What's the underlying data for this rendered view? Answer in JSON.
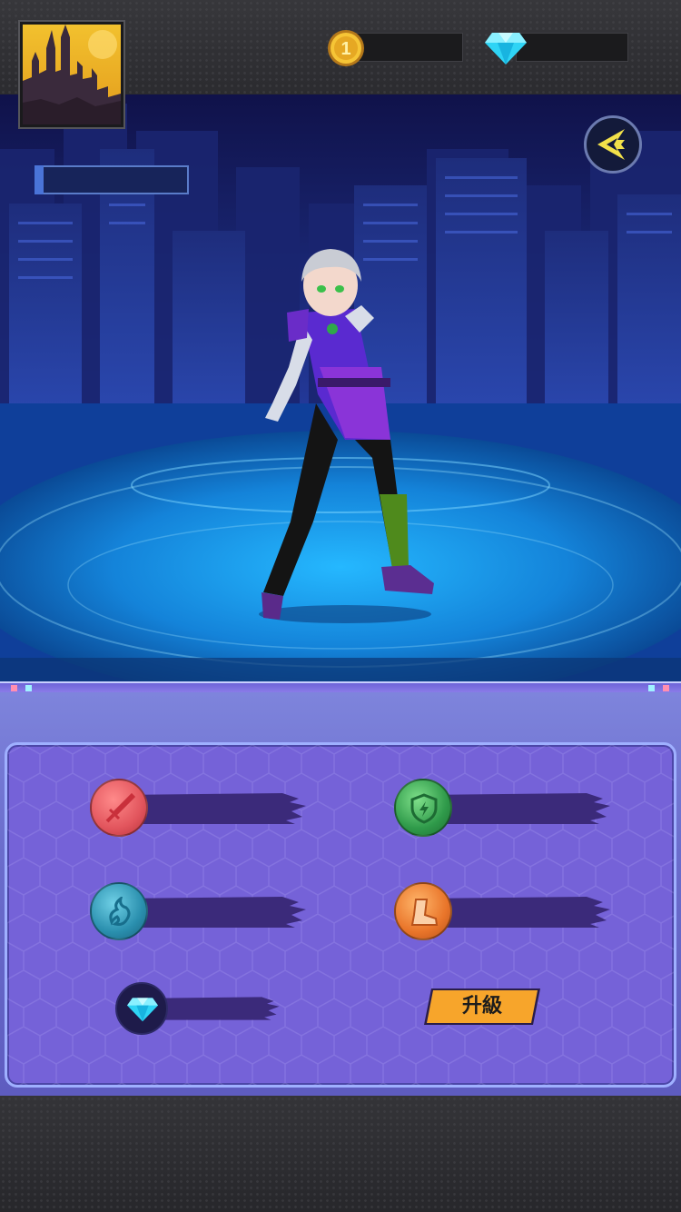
{
  "header": {
    "portrait_icon": "castle-portrait-icon",
    "coin": {
      "icon": "coin-icon",
      "value": ""
    },
    "gem": {
      "icon": "diamond-icon",
      "value": ""
    }
  },
  "scene": {
    "name_label": "",
    "back_button_icon": "back-arrow-icon",
    "character": "hero-character-sprite"
  },
  "stats": {
    "attack": {
      "icon": "sword-icon",
      "value": ""
    },
    "defense": {
      "icon": "shield-icon",
      "value": ""
    },
    "spirit": {
      "icon": "flame-spirit-icon",
      "value": ""
    },
    "speed": {
      "icon": "boot-icon",
      "value": ""
    },
    "cost": {
      "icon": "diamond-icon",
      "value": ""
    }
  },
  "upgrade": {
    "label": "升級"
  },
  "colors": {
    "attack": "#e2555d",
    "defense": "#2f9a4a",
    "spirit": "#2a8fae",
    "speed": "#e9752a",
    "panel": "#7562d8",
    "upgrade_button": "#f7a52b"
  }
}
